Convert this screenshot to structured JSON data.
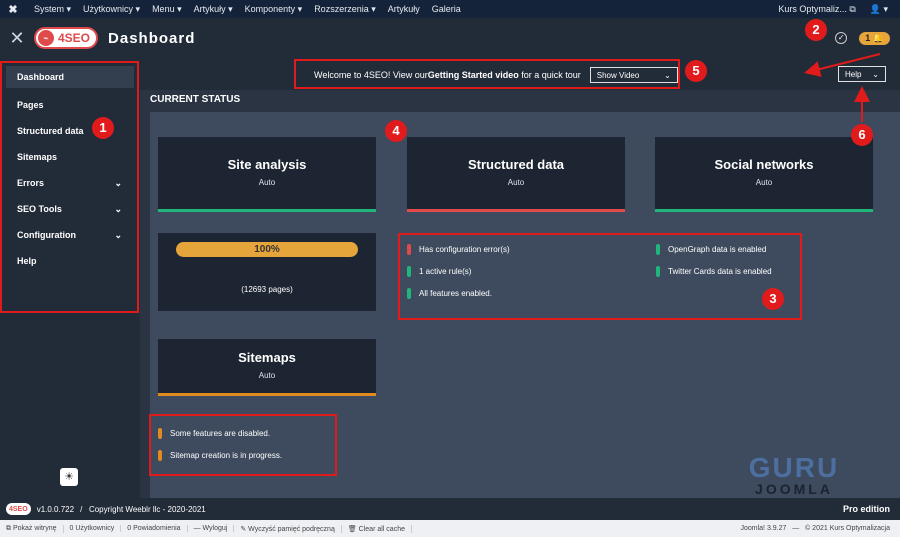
{
  "topbar": {
    "logo": "✖",
    "menu": [
      "System ▾",
      "Użytkownicy ▾",
      "Menu ▾",
      "Artykuły ▾",
      "Komponenty ▾",
      "Rozszerzenia ▾",
      "Artykuły",
      "Galeria"
    ],
    "site": "Kurs Optymaliz... ⧉",
    "user": "👤 ▾"
  },
  "header": {
    "close": "✕",
    "logo_text": "4SEO",
    "title": "Dashboard",
    "bell_count": "1 🔔"
  },
  "sidebar": {
    "items": [
      {
        "label": "Dashboard",
        "chev": ""
      },
      {
        "label": "Pages",
        "chev": ""
      },
      {
        "label": "Structured data",
        "chev": ""
      },
      {
        "label": "Sitemaps",
        "chev": ""
      },
      {
        "label": "Errors",
        "chev": "⌄"
      },
      {
        "label": "SEO Tools",
        "chev": "⌄"
      },
      {
        "label": "Configuration",
        "chev": "⌄"
      },
      {
        "label": "Help",
        "chev": ""
      }
    ]
  },
  "welcome": {
    "pre": "Welcome to 4SEO! View our ",
    "link": "Getting Started video",
    "post": " for a quick tour",
    "show_video": "Show Video",
    "help": "Help"
  },
  "status_title": "CURRENT STATUS",
  "cards": [
    {
      "title": "Site analysis",
      "sub": "Auto",
      "color": "#1fb57b"
    },
    {
      "title": "Structured data",
      "sub": "Auto",
      "color": "#e04a4a"
    },
    {
      "title": "Social networks",
      "sub": "Auto",
      "color": "#1fb57b"
    },
    {
      "title": "Sitemaps",
      "sub": "Auto",
      "color": "#e08a1f"
    }
  ],
  "progress": {
    "percent": "100%",
    "pages": "(12693 pages)"
  },
  "sd_features": [
    {
      "text": "Has configuration error(s)",
      "color": "#e04a4a"
    },
    {
      "text": "1 active rule(s)",
      "color": "#1fb57b"
    },
    {
      "text": "All features enabled.",
      "color": "#1fb57b"
    }
  ],
  "sn_features": [
    {
      "text": "OpenGraph data is enabled",
      "color": "#1fb57b"
    },
    {
      "text": "Twitter Cards data is enabled",
      "color": "#1fb57b"
    }
  ],
  "sm_features": [
    {
      "text": "Some features are disabled.",
      "color": "#e08a1f"
    },
    {
      "text": "Sitemap creation is in progress.",
      "color": "#e08a1f"
    }
  ],
  "annotations": [
    "1",
    "2",
    "3",
    "4",
    "5",
    "6"
  ],
  "watermark": {
    "line1": "GURU",
    "line2": "JOOMLA"
  },
  "footer": {
    "logo": "4SEO",
    "version": "v1.0.0.722",
    "copyright": "/   Copyright Weeblr llc - 2020-2021",
    "edition": "Pro edition"
  },
  "statusbar": {
    "items": [
      "⧉ Pokaż witrynę",
      "0 Użytkownicy",
      "0 Powiadomienia",
      "— Wyloguj",
      "✎ Wyczyść pamięć podręczną",
      "🗑 Clear all cache"
    ],
    "right": "Joomla! 3.9.27   —   © 2021 Kurs Optymalizacja"
  }
}
